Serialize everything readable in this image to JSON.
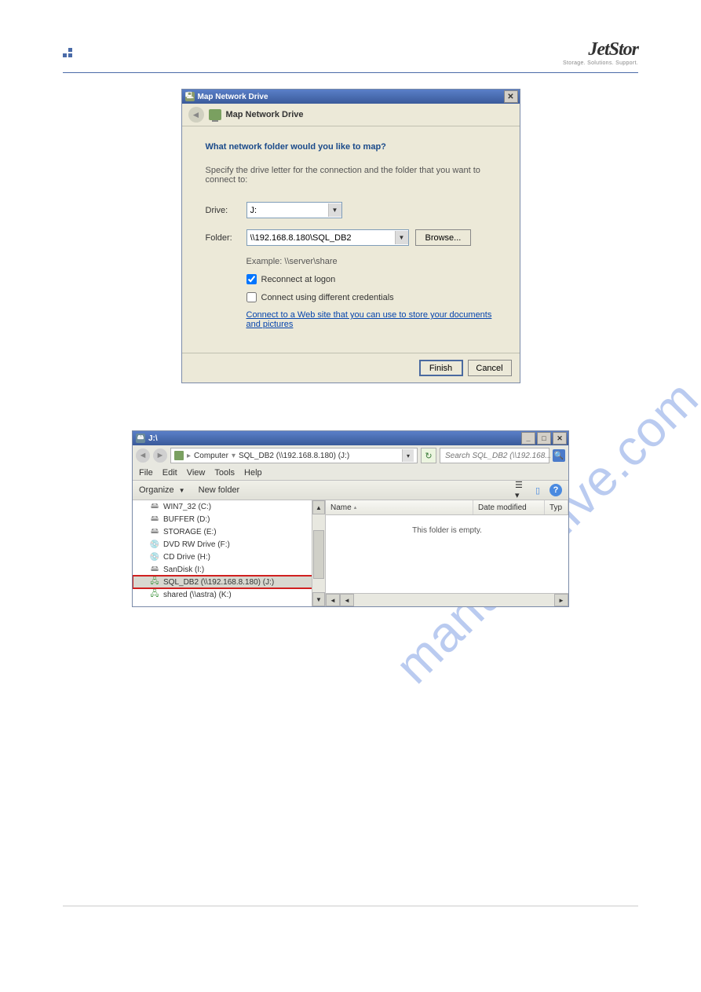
{
  "brand": {
    "name": "JetStor",
    "tagline": "Storage. Solutions. Support."
  },
  "watermark": "manualshive.com",
  "dialog": {
    "title": "Map Network Drive",
    "subheader": "Map Network Drive",
    "question": "What network folder would you like to map?",
    "instruction": "Specify the drive letter for the connection and the folder that you want to connect to:",
    "drive_label": "Drive:",
    "drive_value": "J:",
    "folder_label": "Folder:",
    "folder_value": "\\\\192.168.8.180\\SQL_DB2",
    "browse": "Browse...",
    "example": "Example: \\\\server\\share",
    "reconnect": "Reconnect at logon",
    "different_creds": "Connect using different credentials",
    "link_text": "Connect to a Web site that you can use to store your documents and pictures",
    "finish": "Finish",
    "cancel": "Cancel",
    "reconnect_checked": true,
    "creds_checked": false
  },
  "explorer": {
    "title": "J:\\",
    "breadcrumb": {
      "computer": "Computer",
      "location": "SQL_DB2 (\\\\192.168.8.180) (J:)"
    },
    "search_placeholder": "Search SQL_DB2 (\\\\192.168....",
    "menus": [
      "File",
      "Edit",
      "View",
      "Tools",
      "Help"
    ],
    "toolbar": {
      "organize": "Organize",
      "new_folder": "New folder"
    },
    "columns": {
      "name": "Name",
      "date": "Date modified",
      "type": "Typ"
    },
    "empty": "This folder is empty.",
    "tree": [
      {
        "label": "WIN7_32 (C:)",
        "icon": "drive"
      },
      {
        "label": "BUFFER (D:)",
        "icon": "drive"
      },
      {
        "label": "STORAGE (E:)",
        "icon": "drive"
      },
      {
        "label": "DVD RW Drive (F:)",
        "icon": "dvd"
      },
      {
        "label": "CD Drive (H:)",
        "icon": "dvd"
      },
      {
        "label": "SanDisk (I:)",
        "icon": "drive"
      },
      {
        "label": "SQL_DB2 (\\\\192.168.8.180) (J:)",
        "icon": "net",
        "selected": true,
        "highlighted": true
      },
      {
        "label": "shared (\\\\astra) (K:)",
        "icon": "net"
      }
    ]
  }
}
